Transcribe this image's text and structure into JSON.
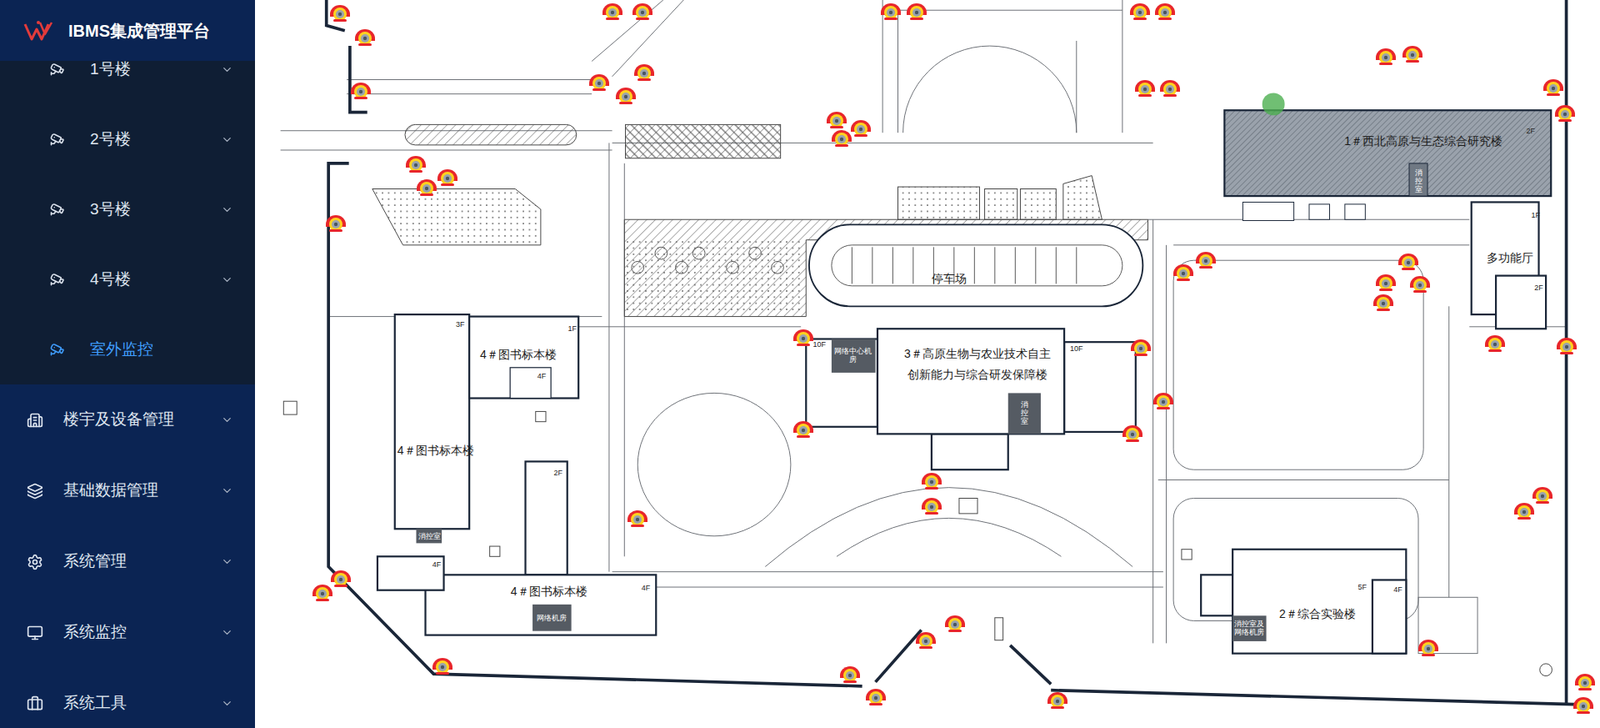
{
  "app": {
    "title": "IBMS集成管理平台"
  },
  "sidebar": {
    "submenu": [
      {
        "label": "1号楼",
        "selected": false,
        "expandable": true
      },
      {
        "label": "2号楼",
        "selected": false,
        "expandable": true
      },
      {
        "label": "3号楼",
        "selected": false,
        "expandable": true
      },
      {
        "label": "4号楼",
        "selected": false,
        "expandable": true
      },
      {
        "label": "室外监控",
        "selected": true,
        "expandable": false
      }
    ],
    "items": [
      {
        "label": "楼宇及设备管理",
        "expanded": false
      },
      {
        "label": "基础数据管理",
        "expanded": false
      },
      {
        "label": "系统管理",
        "expanded": false
      },
      {
        "label": "系统监控",
        "expanded": false
      },
      {
        "label": "系统工具",
        "expanded": false
      }
    ]
  },
  "map": {
    "labels": [
      {
        "text": "1＃西北高原与生态综合研究楼",
        "kind": "building"
      },
      {
        "text": "2F",
        "kind": "floor"
      },
      {
        "text": "消控室",
        "kind": "vertical"
      },
      {
        "text": "多功能厅",
        "kind": "building"
      },
      {
        "text": "1F",
        "kind": "floor"
      },
      {
        "text": "2F",
        "kind": "floor"
      },
      {
        "text": "停车场",
        "kind": "building"
      },
      {
        "text": "3＃高原生物与农业技术自主",
        "kind": "building"
      },
      {
        "text": "创新能力与综合研发保障楼",
        "kind": "building"
      },
      {
        "text": "10F",
        "kind": "floor"
      },
      {
        "text": "10F",
        "kind": "floor"
      },
      {
        "text": "网络中心机房",
        "kind": "room"
      },
      {
        "text": "消控室",
        "kind": "vertical"
      },
      {
        "text": "4＃图书标本楼",
        "kind": "building"
      },
      {
        "text": "3F",
        "kind": "floor"
      },
      {
        "text": "1F",
        "kind": "floor"
      },
      {
        "text": "4F",
        "kind": "floor"
      },
      {
        "text": "4＃图书标本楼",
        "kind": "building"
      },
      {
        "text": "2F",
        "kind": "floor"
      },
      {
        "text": "消控室",
        "kind": "room"
      },
      {
        "text": "4F",
        "kind": "floor"
      },
      {
        "text": "4＃图书标本楼",
        "kind": "building"
      },
      {
        "text": "4F",
        "kind": "floor"
      },
      {
        "text": "网络机房",
        "kind": "room"
      },
      {
        "text": "2＃综合实验楼",
        "kind": "building"
      },
      {
        "text": "5F",
        "kind": "floor"
      },
      {
        "text": "4F",
        "kind": "floor"
      },
      {
        "text": "消控室及网络机房",
        "kind": "room"
      }
    ]
  }
}
